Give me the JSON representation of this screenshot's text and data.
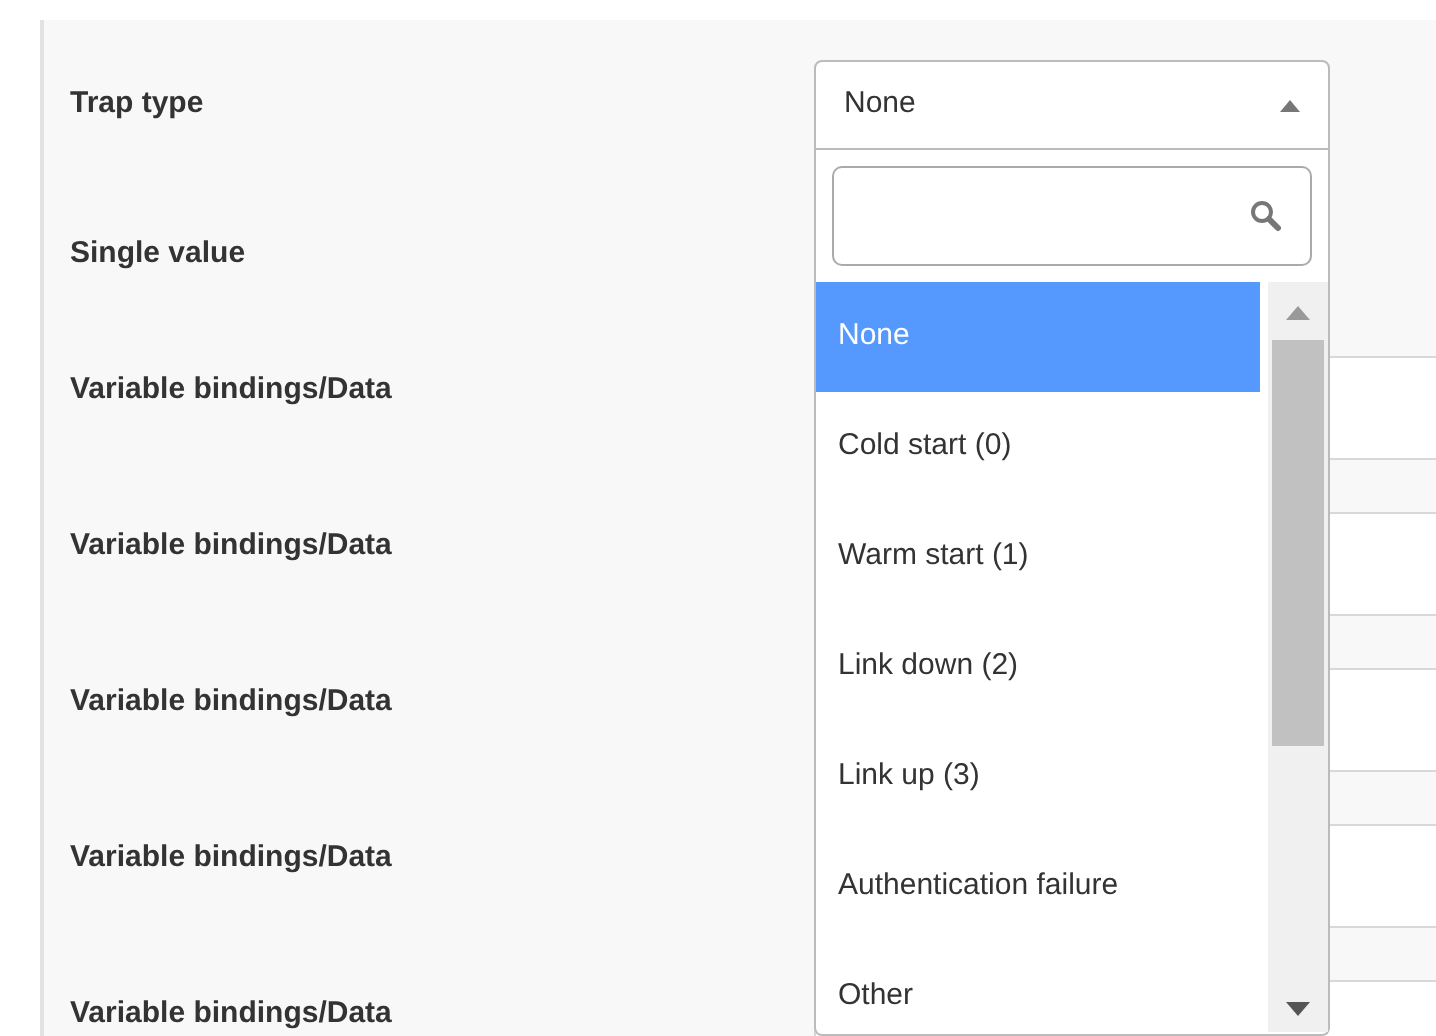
{
  "fields": [
    {
      "label": "Trap type",
      "kind": "select"
    },
    {
      "label": "Single value",
      "kind": "plain"
    },
    {
      "label": "Variable bindings/Data",
      "kind": "input"
    },
    {
      "label": "Variable bindings/Data",
      "kind": "input"
    },
    {
      "label": "Variable bindings/Data",
      "kind": "input"
    },
    {
      "label": "Variable bindings/Data",
      "kind": "input"
    },
    {
      "label": "Variable bindings/Data",
      "kind": "input"
    }
  ],
  "dropdown": {
    "value": "None",
    "expanded": true,
    "options": [
      {
        "label": "None",
        "selected": true
      },
      {
        "label": "Cold start (0)",
        "selected": false
      },
      {
        "label": "Warm start (1)",
        "selected": false
      },
      {
        "label": "Link down (2)",
        "selected": false
      },
      {
        "label": "Link up (3)",
        "selected": false
      },
      {
        "label": "Authentication failure",
        "selected": false
      },
      {
        "label": "Other",
        "selected": false
      }
    ]
  }
}
